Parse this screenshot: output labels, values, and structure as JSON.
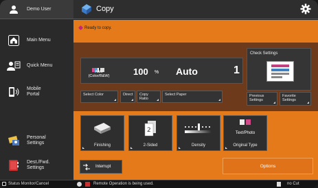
{
  "sidebar": {
    "user_label": "Demo User",
    "items": [
      {
        "label": "Main Menu"
      },
      {
        "label": "Quick Menu"
      },
      {
        "label": "Mobile\nPortal"
      },
      {
        "label": "Personal\nSettings"
      },
      {
        "label": "Dest./Fwd.\nSettings"
      }
    ]
  },
  "header": {
    "title": "Copy"
  },
  "status": {
    "message": "Ready to copy."
  },
  "settings": {
    "color_value": "Auto\n(Color/B&W)",
    "ratio_value": "100",
    "ratio_unit": "%",
    "paper_value": "Auto",
    "copies_value": "1",
    "check_settings_label": "Check Settings",
    "buttons": {
      "select_color": "Select Color",
      "direct": "Direct",
      "copy_ratio": "Copy\nRatio",
      "select_paper": "Select Paper",
      "previous_settings": "Previous\nSettings",
      "favorite_settings": "Favorite\nSettings"
    }
  },
  "functions": [
    {
      "label": "Finishing"
    },
    {
      "label": "2-Sided"
    },
    {
      "label": "Density"
    },
    {
      "label": "Original Type",
      "value": "Text/Photo"
    }
  ],
  "actions": {
    "interrupt": "Interrupt",
    "options": "Options"
  },
  "statusbar": {
    "monitor": "Status Monitor/Cancel",
    "remote": "Remote Operation is being used.",
    "paper_out": "no Cut"
  },
  "colors": {
    "accent": "#e47a1a",
    "panel_dark": "#6d3a1c",
    "chrome": "#2a2a2a"
  }
}
